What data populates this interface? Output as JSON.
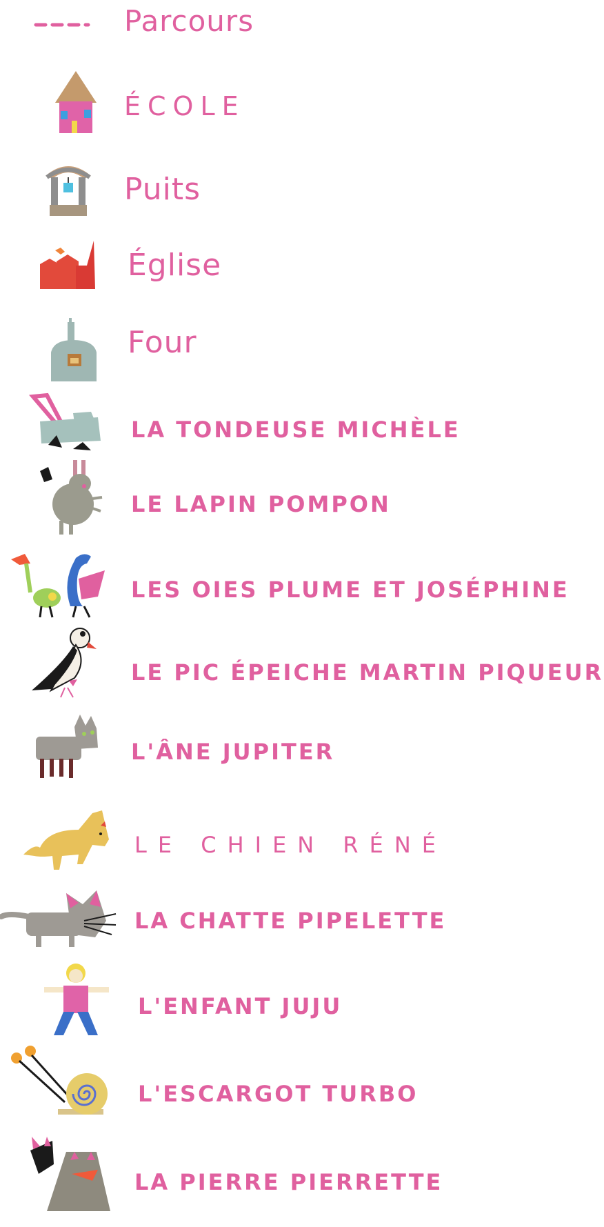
{
  "colors": {
    "text": "#e0609f",
    "background": "#ffffff"
  },
  "legend": {
    "items": [
      {
        "id": "parcours",
        "label": "Parcours",
        "icon": "dashed-route-line-icon"
      },
      {
        "id": "ecole",
        "label": "ÉCOLE",
        "icon": "school-house-icon"
      },
      {
        "id": "puits",
        "label": "Puits",
        "icon": "well-icon"
      },
      {
        "id": "eglise",
        "label": "Église",
        "icon": "church-icon"
      },
      {
        "id": "four",
        "label": "Four",
        "icon": "oven-icon"
      },
      {
        "id": "tondeuse",
        "label": "LA TONDEUSE MICHÈLE",
        "icon": "lawnmower-icon"
      },
      {
        "id": "lapin",
        "label": "LE LAPIN POMPON",
        "icon": "rabbit-icon"
      },
      {
        "id": "oies",
        "label": "LES OIES PLUME ET JOSÉPHINE",
        "icon": "geese-icon"
      },
      {
        "id": "pic",
        "label": "LE PIC ÉPEICHE MARTIN PIQUEUR",
        "icon": "woodpecker-icon"
      },
      {
        "id": "ane",
        "label": "L'ÂNE JUPITER",
        "icon": "donkey-icon"
      },
      {
        "id": "chien",
        "label": "LE CHIEN RÉNÉ",
        "icon": "dog-icon"
      },
      {
        "id": "chatte",
        "label": "LA CHATTE PIPELETTE",
        "icon": "cat-icon"
      },
      {
        "id": "enfant",
        "label": "L'ENFANT JUJU",
        "icon": "child-icon"
      },
      {
        "id": "escargot",
        "label": "L'ESCARGOT TURBO",
        "icon": "snail-icon"
      },
      {
        "id": "pierre",
        "label": "LA PIERRE PIERRETTE",
        "icon": "stone-icon"
      }
    ]
  }
}
